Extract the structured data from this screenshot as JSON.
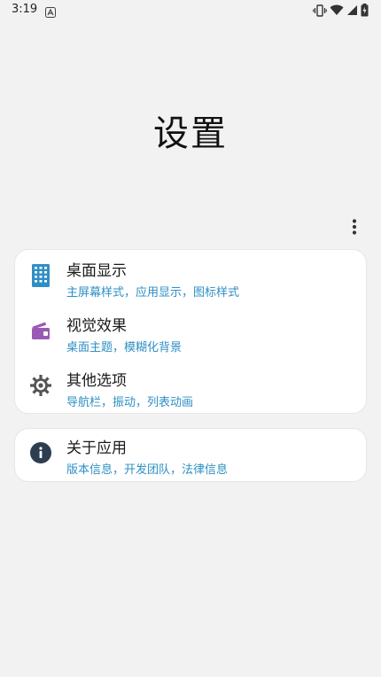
{
  "status_bar": {
    "time": "3:19",
    "icons": [
      "notification-a-icon",
      "vibrate-icon",
      "wifi-icon",
      "signal-icon",
      "battery-charging-icon"
    ]
  },
  "page": {
    "title": "设置"
  },
  "menu": {
    "icon": "more-vert-icon"
  },
  "sections": {
    "main": [
      {
        "icon": "building-icon",
        "icon_color": "#2e8fc4",
        "title": "桌面显示",
        "subtitle": "主屏幕样式，应用显示，图标样式"
      },
      {
        "icon": "wallet-icon",
        "icon_color": "#9b59b6",
        "title": "视觉效果",
        "subtitle": "桌面主题，模糊化背景"
      },
      {
        "icon": "gear-icon",
        "icon_color": "#555555",
        "title": "其他选项",
        "subtitle": "导航栏，振动，列表动画"
      }
    ],
    "about": [
      {
        "icon": "info-icon",
        "icon_color": "#2c3e50",
        "title": "关于应用",
        "subtitle": "版本信息，开发团队，法律信息"
      }
    ]
  },
  "colors": {
    "background": "#f2f2f2",
    "card": "#ffffff",
    "subtitle": "#2e8fc4"
  }
}
